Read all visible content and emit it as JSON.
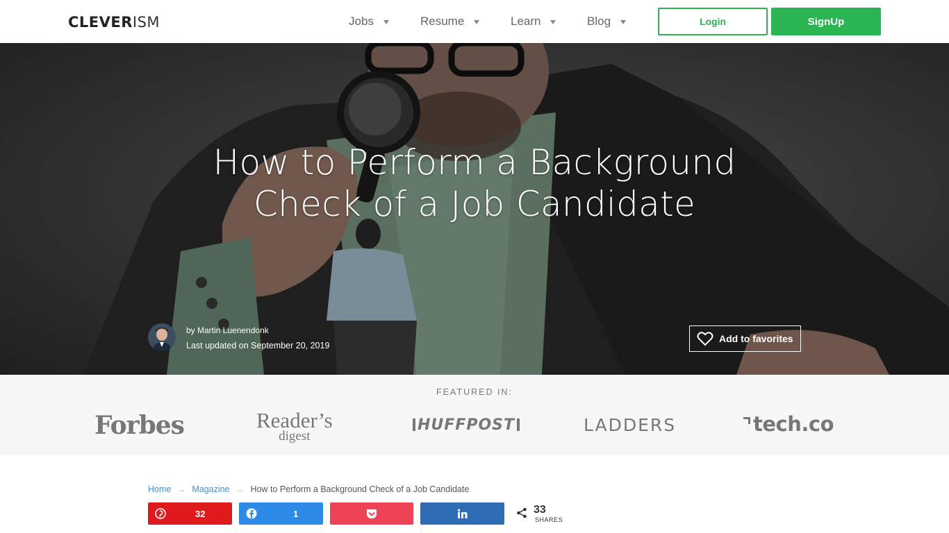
{
  "header": {
    "logo_bold": "CLEVER",
    "logo_light": "ISM",
    "nav": [
      {
        "label": "Jobs"
      },
      {
        "label": "Resume"
      },
      {
        "label": "Learn"
      },
      {
        "label": "Blog"
      }
    ],
    "login_label": "Login",
    "signup_label": "SignUp"
  },
  "hero": {
    "title_line1": "How to Perform a Background",
    "title_line2": "Check of a Job Candidate",
    "author_by": "by Martin Luenendonk",
    "updated": "Last updated on September 20, 2019",
    "favorites_label": "Add to favorites"
  },
  "featured": {
    "label": "FEATURED IN:",
    "brands": {
      "forbes": "Forbes",
      "rd_main": "Reader’s",
      "rd_sub": "digest",
      "huff": "HUFFPOST",
      "ladders": "LADDERS",
      "tech": "tech.co"
    }
  },
  "breadcrumb": {
    "home": "Home",
    "magazine": "Magazine",
    "current": "How to Perform a Background Check of a Job Candidate"
  },
  "share": {
    "pinterest_count": "32",
    "facebook_count": "1",
    "total": "33",
    "total_label": "SHARES"
  },
  "colors": {
    "brand_green": "#2ab552",
    "pinterest": "#e0191d",
    "facebook": "#2d8ae6",
    "pocket": "#ee4256",
    "linkedin": "#2e6db4"
  }
}
